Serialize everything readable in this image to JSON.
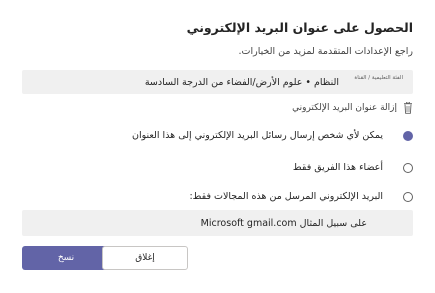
{
  "dialog": {
    "title": "الحصول على عنوان البريد الإلكتروني",
    "subtitle": "راجع الإعدادات المتقدمة لمزيد من الخيارات."
  },
  "team": {
    "caption": "الفئة التعليمية / القناة",
    "name": "النظام • علوم الأرض/الفضاء من الدرجة السادسة"
  },
  "remove_email": {
    "label": "إزالة عنوان البريد الإلكتروني",
    "icon": "trash-icon"
  },
  "options": [
    {
      "label": "يمكن لأي شخص إرسال رسائل البريد الإلكتروني إلى هذا العنوان",
      "selected": true
    },
    {
      "label": "أعضاء هذا الفريق فقط",
      "selected": false
    },
    {
      "label": "البريد الإلكتروني المرسل من هذه المجالات فقط:",
      "selected": false
    }
  ],
  "domain_field": {
    "value": "على سبيل المثال Microsoft gmail.com"
  },
  "buttons": {
    "copy": "نسخ",
    "close": "إغلاق"
  },
  "colors": {
    "accent": "#6264a7",
    "field_bg": "#f0f0f0"
  }
}
